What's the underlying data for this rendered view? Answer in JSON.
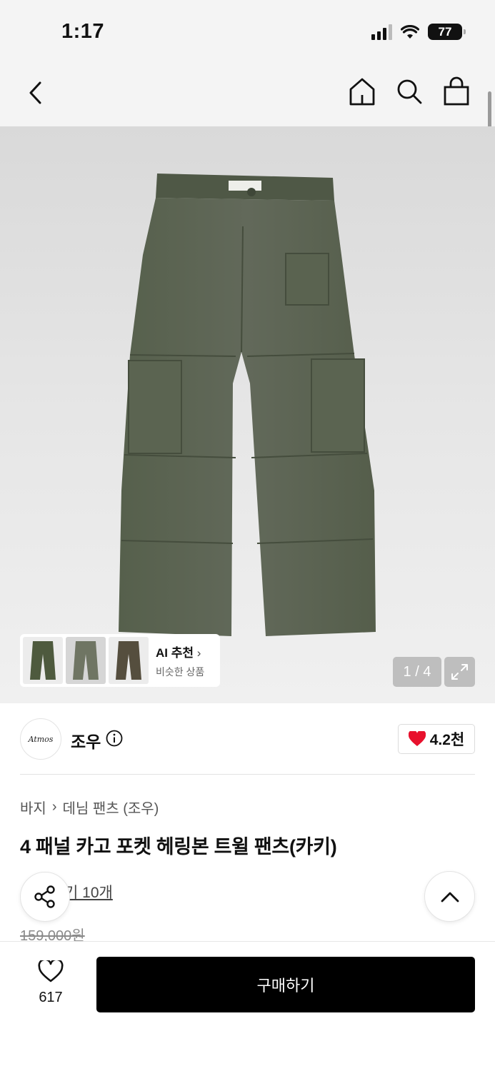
{
  "status_bar": {
    "time": "1:17",
    "battery": "77"
  },
  "header": {
    "back_icon": "chevron-left-icon",
    "icons": [
      "home-icon",
      "search-icon",
      "shopping-bag-icon"
    ]
  },
  "gallery": {
    "counter": "1 / 4",
    "ai_recommend": {
      "title": "AI 추천",
      "subtitle": "비슷한 상품"
    }
  },
  "brand": {
    "logo_text": "Atmos",
    "name": "조우",
    "likes": "4.2천"
  },
  "product": {
    "breadcrumb": [
      "바지",
      "데님 팬츠 (조우)"
    ],
    "title": "4 패널 카고 포켓 헤링본 트윌 팬츠(카키)",
    "reviews": "기 10개",
    "original_price": "159,000원"
  },
  "bottom_bar": {
    "wish_count": "617",
    "buy_label": "구매하기"
  },
  "colors": {
    "accent": "#000000",
    "heart": "#e8112d",
    "product": "#5a6350"
  }
}
